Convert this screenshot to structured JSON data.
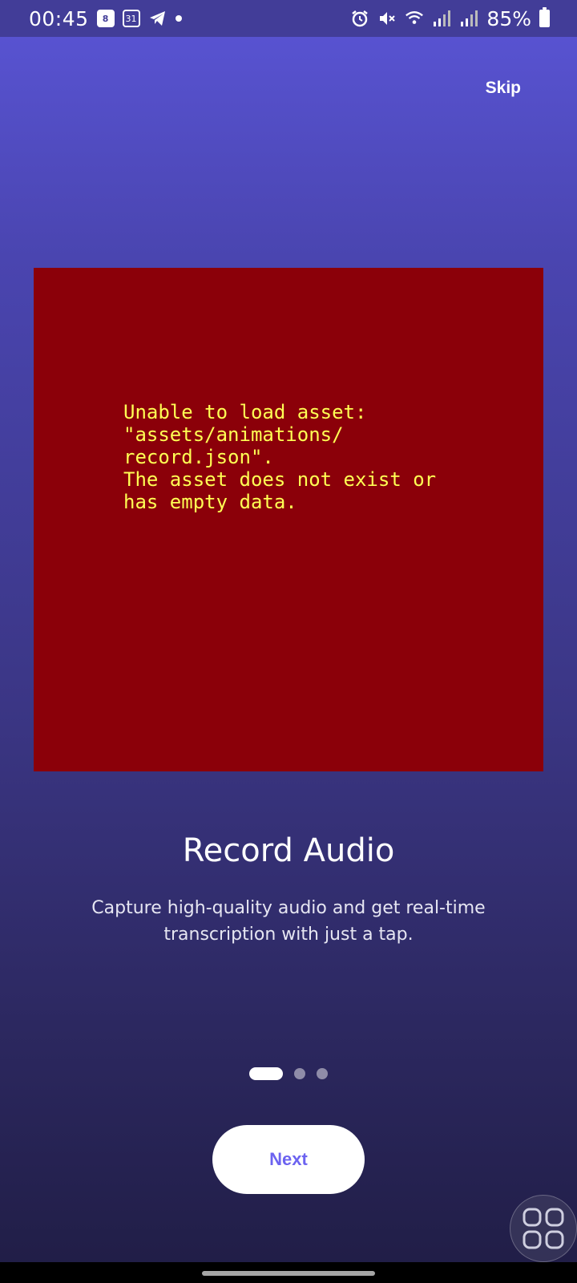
{
  "status_bar": {
    "time": "00:45",
    "badge_1": "8",
    "badge_2": "31",
    "battery_percent": "85%"
  },
  "header": {
    "skip_label": "Skip"
  },
  "error": {
    "message": "Unable to load asset:\n\"assets/animations/\nrecord.json\".\nThe asset does not exist or\nhas empty data."
  },
  "content": {
    "title": "Record Audio",
    "description": "Capture high-quality audio and get real-time transcription with just a tap."
  },
  "pager": {
    "total": 3,
    "current": 1
  },
  "actions": {
    "next_label": "Next"
  },
  "colors": {
    "accent": "#6c63f0",
    "error_bg": "#8b0009",
    "error_text": "#ffff54"
  }
}
